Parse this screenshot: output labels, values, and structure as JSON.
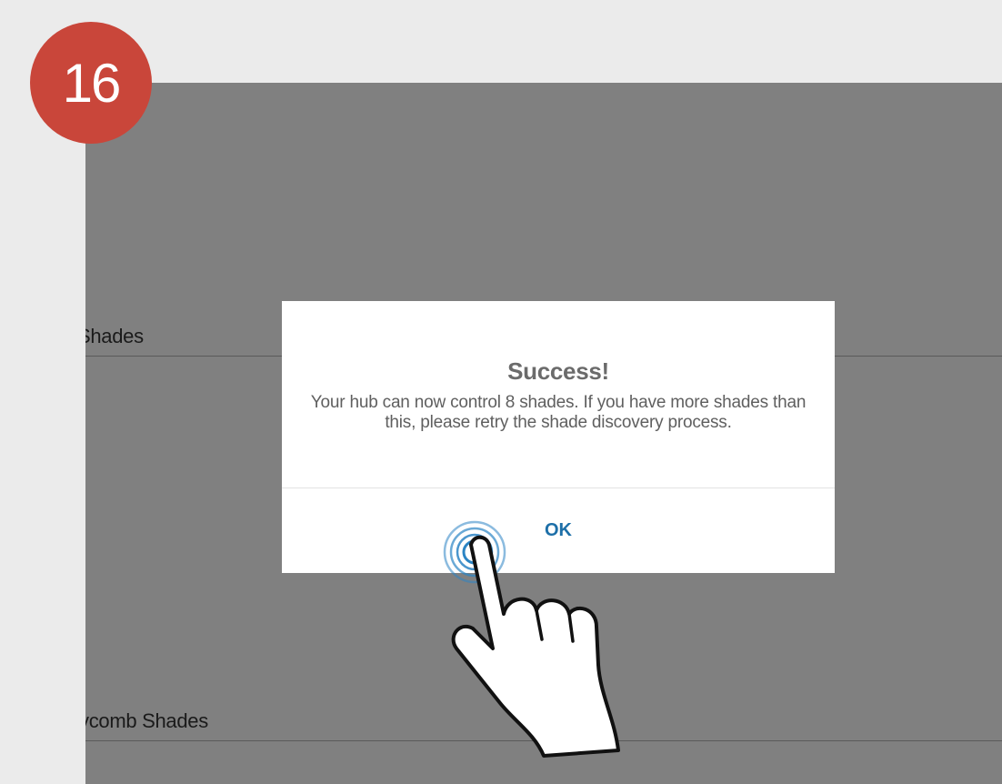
{
  "step_badge": {
    "number": "16",
    "color": "#c9463a"
  },
  "background_list": {
    "rows": [
      {
        "label": "Shades"
      },
      {
        "label": "ycomb Shades"
      }
    ]
  },
  "dialog": {
    "title": "Success!",
    "message": "Your hub can now control 8 shades. If you have more shades than this, please retry the shade discovery process.",
    "ok_label": "OK"
  },
  "colors": {
    "page_background": "#ebebeb",
    "screen_overlay": "#808080",
    "dialog_background": "#ffffff",
    "ok_accent": "#1d6fa8",
    "title_text": "#6b6b6b"
  },
  "icons": {
    "tap_gesture": "tap-hand-icon"
  }
}
